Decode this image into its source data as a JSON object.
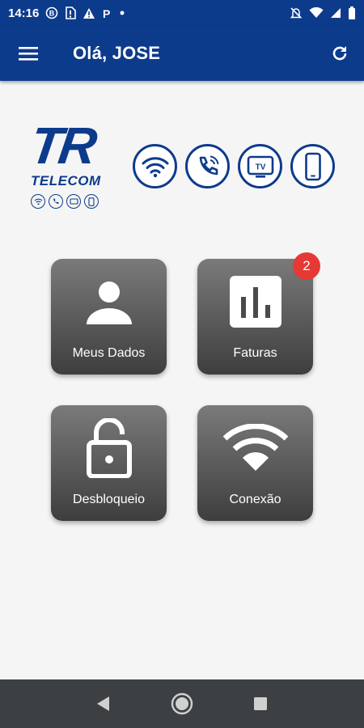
{
  "status_bar": {
    "time": "14:16",
    "left_icons": [
      "b-circle-icon",
      "sim-alert-icon",
      "warning-icon",
      "parking-icon",
      "dot-icon"
    ],
    "right_icons": [
      "bell-off-icon",
      "wifi-icon",
      "signal-icon",
      "battery-icon"
    ]
  },
  "app_bar": {
    "title": "Olá, JOSE",
    "menu_icon": "menu-icon",
    "refresh_icon": "refresh-icon"
  },
  "brand": {
    "logo_main": "TR",
    "logo_sub": "TELECOM",
    "services": [
      "wifi-icon",
      "phone-icon",
      "tv-icon",
      "smartphone-icon"
    ],
    "tv_label": "TV"
  },
  "tiles": [
    {
      "label": "Meus Dados",
      "icon": "user-icon"
    },
    {
      "label": "Faturas",
      "icon": "chart-icon",
      "badge": "2"
    },
    {
      "label": "Desbloqueio",
      "icon": "unlock-icon"
    },
    {
      "label": "Conexão",
      "icon": "wifi-icon"
    }
  ],
  "colors": {
    "primary": "#0d3b8c",
    "badge": "#e53935",
    "nav_bar": "#3c4043"
  },
  "nav_bar": {
    "buttons": [
      "back-icon",
      "home-icon",
      "recents-icon"
    ]
  }
}
